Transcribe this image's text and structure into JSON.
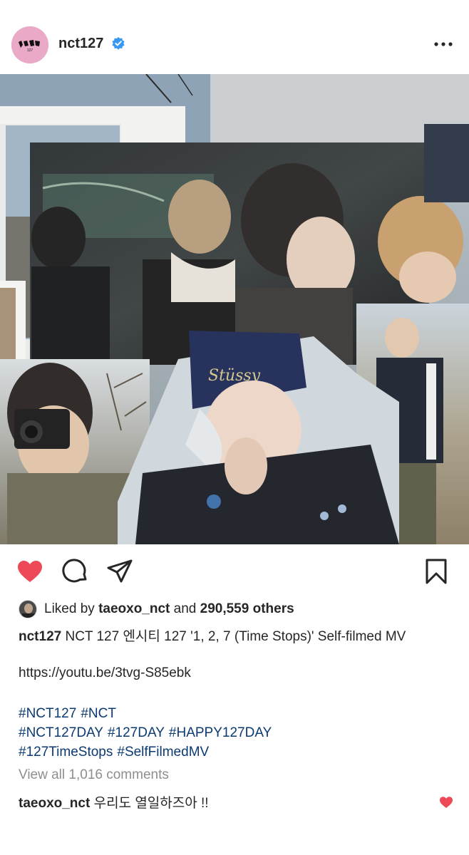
{
  "post": {
    "username": "nct127",
    "avatar_text": "127",
    "verified_icon": "verified-badge-icon",
    "more_icon": "more-options-icon"
  },
  "actions": {
    "like_icon": "heart-filled-icon",
    "comment_icon": "comment-icon",
    "share_icon": "send-icon",
    "save_icon": "bookmark-icon",
    "liked_color": "#ed4956"
  },
  "likes": {
    "prefix": "Liked by",
    "user": "taeoxo_nct",
    "conjunction": "and",
    "count": "290,559 others"
  },
  "caption": {
    "username": "nct127",
    "text": "NCT 127 엔시티 127 '1, 2, 7 (Time Stops)' Self-filmed MV",
    "link": "https://youtu.be/3tvg-S85ebk",
    "hashtag_lines": [
      [
        "#NCT127",
        "#NCT"
      ],
      [
        "#NCT127DAY",
        "#127DAY",
        "#HAPPY127DAY"
      ],
      [
        "#127TimeStops",
        "#SelfFilmedMV"
      ]
    ]
  },
  "comments": {
    "view_all": "View all 1,016 comments",
    "top": {
      "username": "taeoxo_nct",
      "text": "우리도 열일하즈아 !!",
      "liked": true
    }
  },
  "colors": {
    "hashtag": "#0b3a72",
    "verified": "#3897f0",
    "avatar_bg": "#eaa9c6"
  }
}
